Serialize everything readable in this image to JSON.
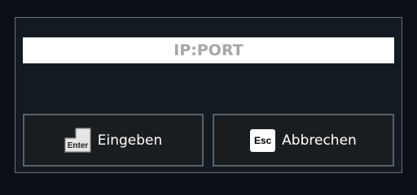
{
  "dialog": {
    "input": {
      "placeholder": "IP:PORT",
      "value": ""
    },
    "confirm_button": {
      "key_label": "Enter",
      "label": "Eingeben",
      "icon": "enter-key-icon"
    },
    "cancel_button": {
      "key_label": "Esc",
      "label": "Abbrechen",
      "icon": "esc-key-icon"
    }
  },
  "colors": {
    "background": "#0c1016",
    "dialog_background": "#131a21",
    "dialog_border": "#6b7078",
    "input_background": "#ffffff",
    "placeholder_text": "#a6a6a6",
    "button_background": "#1a1d20",
    "button_border": "#5a6068",
    "button_text": "#ffffff"
  }
}
